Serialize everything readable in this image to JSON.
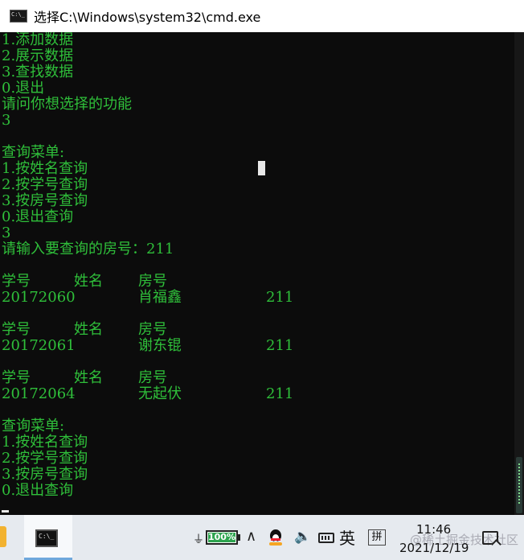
{
  "window": {
    "title": "选择C:\\Windows\\system32\\cmd.exe"
  },
  "console": {
    "lines": [
      "1.添加数据",
      "2.展示数据",
      "3.查找数据",
      "0.退出",
      "请问你想选择的功能",
      "3",
      "",
      "查询菜单:",
      "1.按姓名查询",
      "2.按学号查询",
      "3.按房号查询",
      "0.退出查询",
      "3",
      "请输入要查询的房号：211",
      "",
      "",
      "",
      "",
      "",
      "",
      "",
      "",
      "",
      "",
      "查询菜单:",
      "1.按姓名查询",
      "2.按学号查询",
      "3.按房号查询",
      "0.退出查询"
    ],
    "results": [
      {
        "h_id": "学号",
        "h_name": "姓名",
        "h_room": "房号",
        "id": "20172060",
        "name": "肖福鑫",
        "room": "211"
      },
      {
        "h_id": "学号",
        "h_name": "姓名",
        "h_room": "房号",
        "id": "20172061",
        "name": "谢东锟",
        "room": "211"
      },
      {
        "h_id": "学号",
        "h_name": "姓名",
        "h_room": "房号",
        "id": "20172064",
        "name": "无起伏",
        "room": "211"
      }
    ]
  },
  "taskbar": {
    "battery_text": "100%",
    "battery_level": 1.0,
    "ime_language": "英",
    "ime_mode": "拼",
    "time": "11:46",
    "date": "2021/12/19",
    "watermark": "@稀土掘金技术社区"
  },
  "colors": {
    "console_text": "#2fbf3a",
    "console_bg": "#0c0c0c",
    "taskbar_bg": "#e6eaef"
  }
}
